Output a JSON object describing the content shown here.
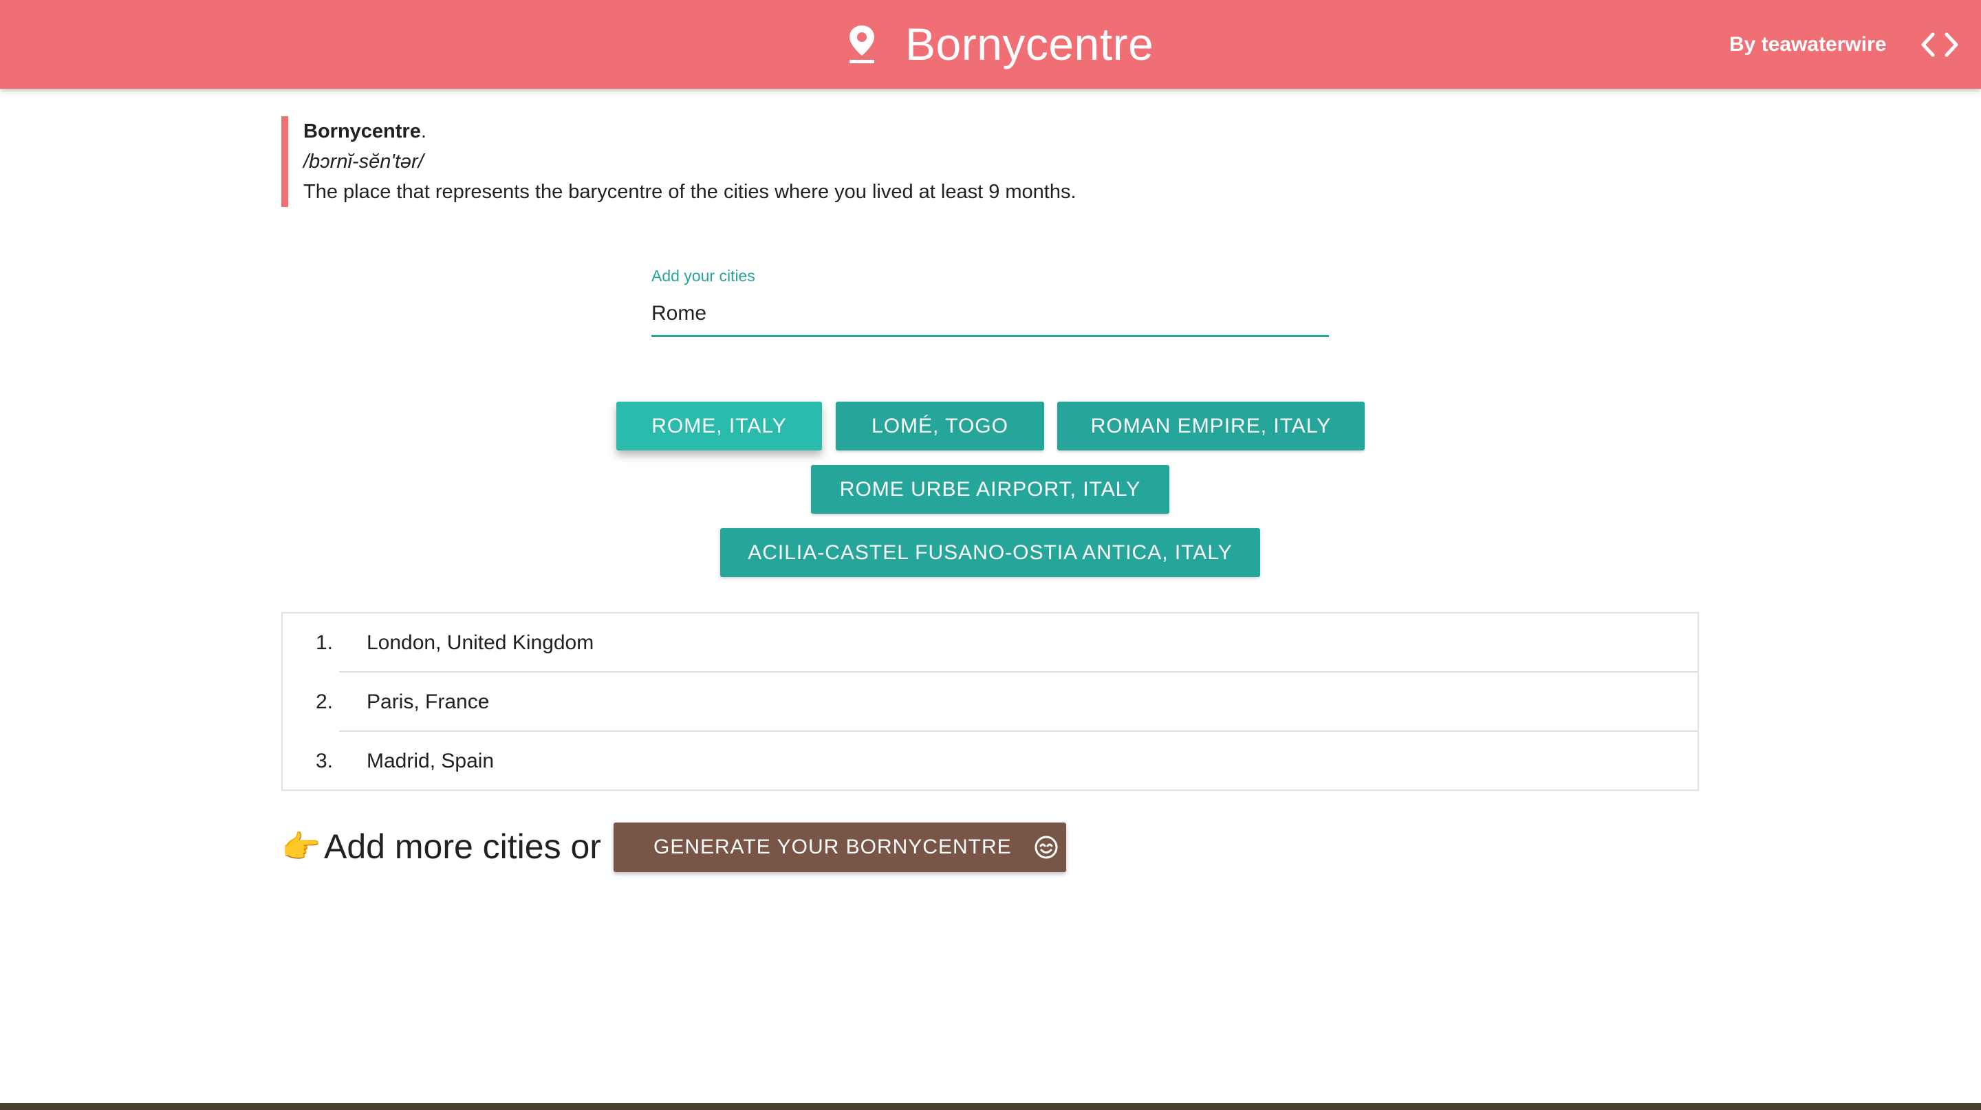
{
  "header": {
    "app_title": "Bornycentre",
    "byline": "By teawaterwire",
    "pin_icon": "map-marker-icon",
    "code_icon": "code-brackets-icon"
  },
  "definition": {
    "term": "Bornycentre",
    "term_suffix": ".",
    "phonetic": "/bɔrnĭ-sĕn'tər/",
    "meaning": "The place that represents the barycentre of the cities where you lived at least 9 months."
  },
  "city_input": {
    "label": "Add your cities",
    "value": "Rome"
  },
  "suggestions": [
    {
      "label": "Rome, Italy",
      "active": true
    },
    {
      "label": "Lomé, Togo",
      "active": false
    },
    {
      "label": "Roman Empire, Italy",
      "active": false
    },
    {
      "label": "Rome Urbe Airport, Italy",
      "active": false
    },
    {
      "label": "Acilia-Castel Fusano-Ostia Antica, Italy",
      "active": false
    }
  ],
  "cities": [
    {
      "num": "1.",
      "name": "London, United Kingdom"
    },
    {
      "num": "2.",
      "name": "Paris, France"
    },
    {
      "num": "3.",
      "name": "Madrid, Spain"
    }
  ],
  "cta": {
    "hand_emoji": "👉",
    "lead_text": "Add more cities or",
    "generate_label": "Generate your Bornycentre",
    "generate_icon": "smile-icon"
  },
  "colors": {
    "header": "#ef6f74",
    "accent": "#26a69a",
    "accent_active": "#2bbbad",
    "generate": "#795548"
  }
}
